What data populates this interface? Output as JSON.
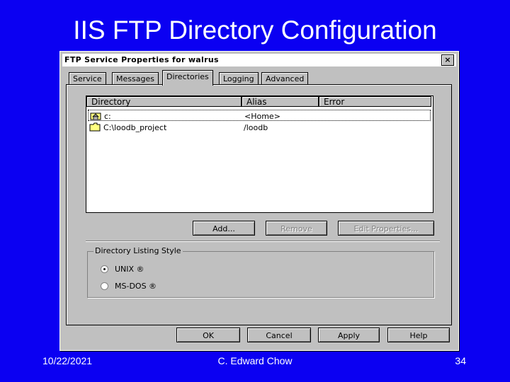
{
  "slide": {
    "title": "IIS FTP Directory Configuration",
    "footer_date": "10/22/2021",
    "footer_author": "C. Edward Chow",
    "footer_page": "34"
  },
  "dialog": {
    "title": "FTP Service Properties for walrus",
    "close": "×",
    "tabs": [
      "Service",
      "Messages",
      "Directories",
      "Logging",
      "Advanced"
    ],
    "active_tab": "Directories",
    "table": {
      "headers": [
        "Directory",
        "Alias",
        "Error"
      ],
      "rows": [
        {
          "directory": "c:",
          "alias": "<Home>",
          "error": "",
          "icon": "home-folder-icon"
        },
        {
          "directory": "C:\\loodb_project",
          "alias": "/loodb",
          "error": "",
          "icon": "folder-icon"
        }
      ]
    },
    "buttons": {
      "add": "Add...",
      "remove": "Remove",
      "edit": "Edit Properties..."
    },
    "listing_style": {
      "legend": "Directory Listing Style",
      "options": [
        "UNIX ®",
        "MS-DOS ®"
      ],
      "selected": "UNIX ®"
    },
    "footer_buttons": {
      "ok": "OK",
      "cancel": "Cancel",
      "apply": "Apply",
      "help": "Help"
    }
  },
  "colors": {
    "slide_background": "#0b00f2",
    "dialog_face": "#c0c0c0"
  }
}
